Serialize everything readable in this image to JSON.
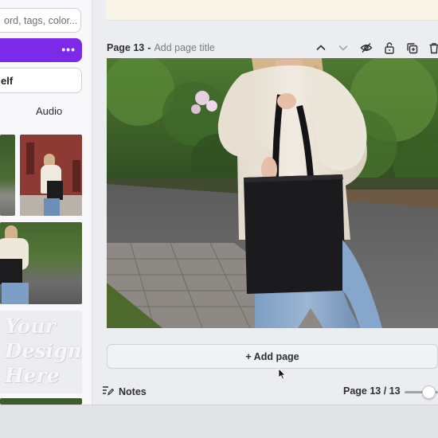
{
  "side_panel": {
    "search_placeholder": "ord, tags, color...",
    "more_label": "•••",
    "tag_button_label": "elf",
    "audio_tab_label": "Audio",
    "watermark_lines": [
      "Your",
      "Design",
      "Here"
    ]
  },
  "page": {
    "number_label": "Page 13",
    "separator": "-",
    "title_placeholder": "Add page title",
    "add_page_label": "+ Add page"
  },
  "footer": {
    "notes_label": "Notes",
    "page_indicator": "Page 13 / 13"
  },
  "colors": {
    "accent_purple": "#7d2ae8",
    "notice_strip": "#faf6e7"
  },
  "icons": [
    "chevron-up-icon",
    "chevron-down-icon",
    "hide-icon",
    "lock-icon",
    "duplicate-icon",
    "trash-icon",
    "notes-icon",
    "mouse-cursor-icon"
  ]
}
